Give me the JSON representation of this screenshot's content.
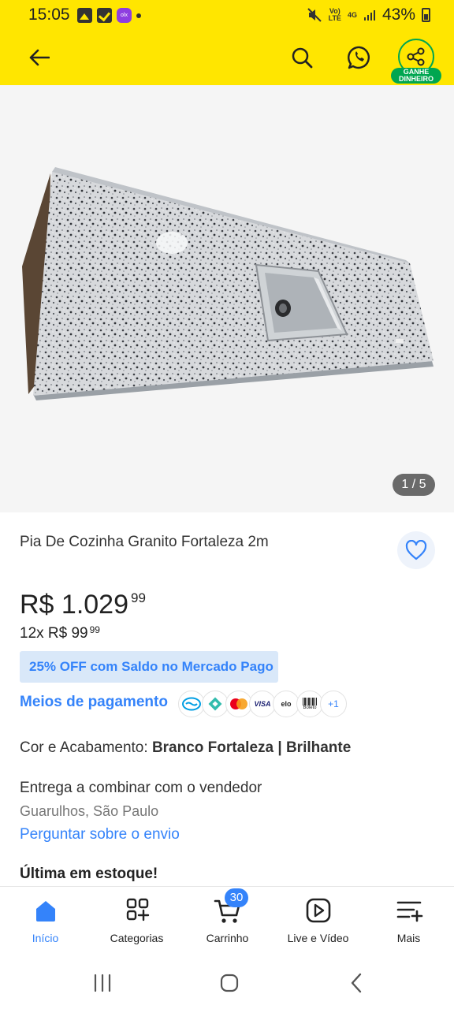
{
  "status_bar": {
    "time": "15:05",
    "app_icon_text": "olx",
    "network_top": "Vo)",
    "network_bottom": "LTE",
    "signal_top": "4G",
    "battery": "43%"
  },
  "header": {
    "ganhe_line1": "GANHE",
    "ganhe_line2": "DINHEIRO"
  },
  "gallery": {
    "counter": "1 / 5"
  },
  "product": {
    "title": "Pia De Cozinha Granito Fortaleza 2m",
    "price_main": "R$ 1.029",
    "price_cents": "99",
    "installments_main": "12x R$ 99",
    "installments_cents": "99",
    "promo": "25% OFF com Saldo no Mercado Pago",
    "payments_link": "Meios de pagamento",
    "payment_more": "+1",
    "payment_visa": "VISA",
    "payment_elo": "elo",
    "payment_boleto": "Boleto",
    "color_label": "Cor e Acabamento: ",
    "color_value": "Branco Fortaleza | Brilhante",
    "delivery": "Entrega a combinar com o vendedor",
    "location": "Guarulhos, São Paulo",
    "ask_shipping": "Perguntar sobre o envio",
    "stock": "Última em estoque!"
  },
  "bottom_nav": {
    "items": [
      {
        "label": "Início",
        "icon": "home-icon"
      },
      {
        "label": "Categorias",
        "icon": "categories-icon"
      },
      {
        "label": "Carrinho",
        "icon": "cart-icon"
      },
      {
        "label": "Live e Vídeo",
        "icon": "play-icon"
      },
      {
        "label": "Mais",
        "icon": "menu-plus-icon"
      }
    ],
    "cart_count": "30"
  },
  "colors": {
    "brand_yellow": "#ffe600",
    "link_blue": "#3483fa",
    "green": "#00a650"
  }
}
